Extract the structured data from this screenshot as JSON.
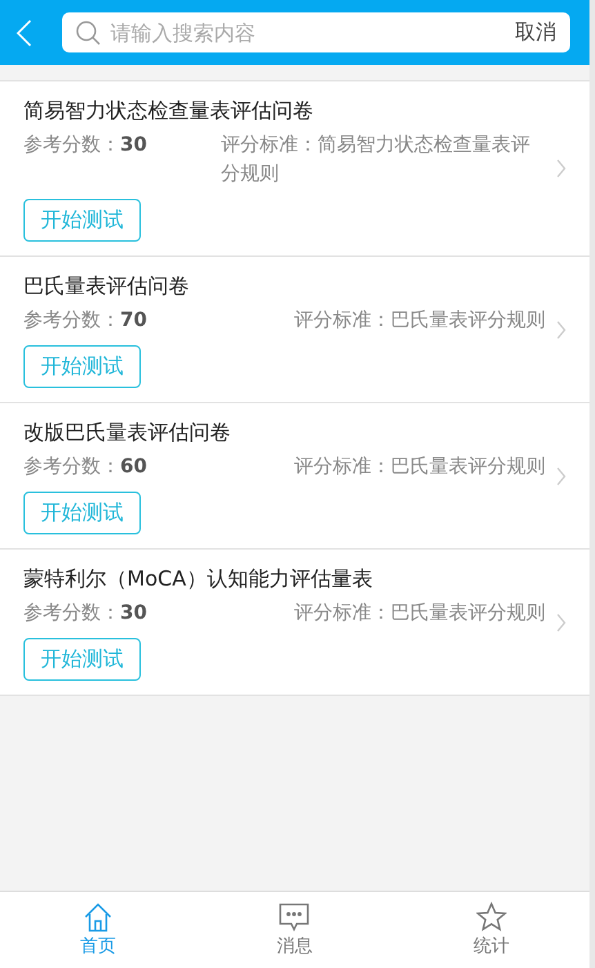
{
  "search": {
    "placeholder": "请输入搜索内容",
    "cancel": "取消"
  },
  "items": [
    {
      "title": "简易智力状态检查量表评估问卷",
      "score_label": "参考分数：",
      "score": "30",
      "criterion": "评分标准：简易智力状态检查量表评分规则",
      "button": "开始测试"
    },
    {
      "title": "巴氏量表评估问卷",
      "score_label": "参考分数：",
      "score": "70",
      "criterion": "评分标准：巴氏量表评分规则",
      "button": "开始测试"
    },
    {
      "title": "改版巴氏量表评估问卷",
      "score_label": "参考分数：",
      "score": "60",
      "criterion": "评分标准：巴氏量表评分规则",
      "button": "开始测试"
    },
    {
      "title": "蒙特利尔（MoCA）认知能力评估量表",
      "score_label": "参考分数：",
      "score": "30",
      "criterion": "评分标准：巴氏量表评分规则",
      "button": "开始测试"
    }
  ],
  "nav": [
    {
      "label": "首页",
      "kind": "home",
      "selected": true
    },
    {
      "label": "消息",
      "kind": "message",
      "selected": false
    },
    {
      "label": "统计",
      "kind": "star",
      "selected": false
    }
  ]
}
